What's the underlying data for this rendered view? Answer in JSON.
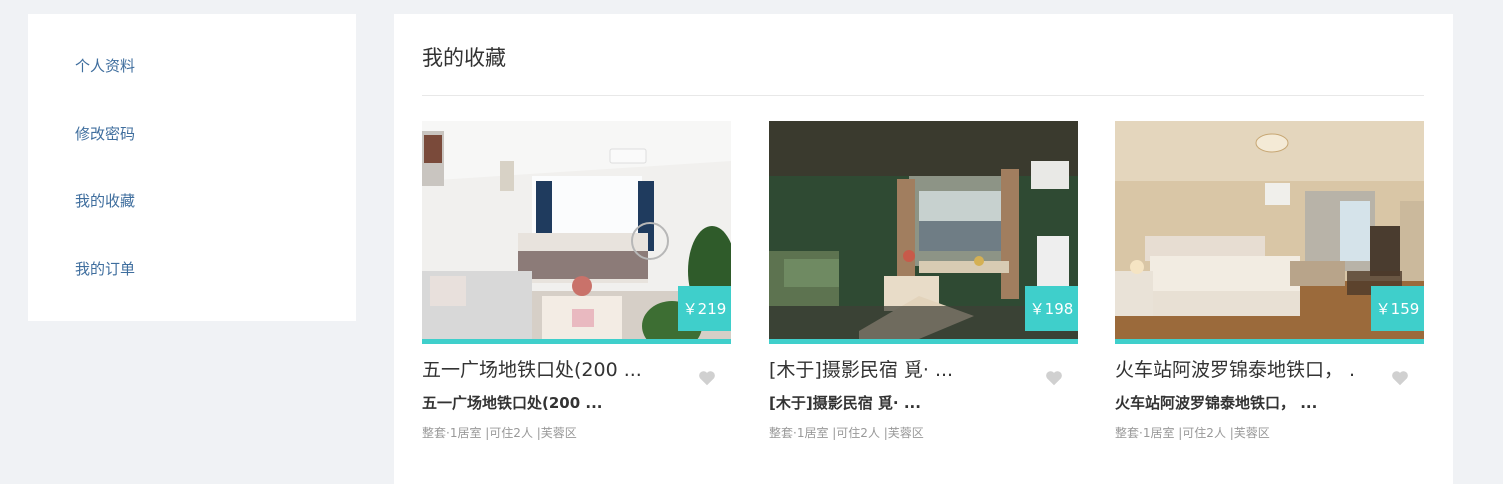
{
  "sidebar": {
    "items": [
      {
        "label": "个人资料"
      },
      {
        "label": "修改密码"
      },
      {
        "label": "我的收藏"
      },
      {
        "label": "我的订单"
      }
    ]
  },
  "main": {
    "title": "我的收藏",
    "cards": [
      {
        "price": "￥219",
        "title": "五一广场地铁口处(200 ...",
        "subtitle": "五一广场地铁口处(200 ...",
        "meta": "整套·1居室 |可住2人 |芙蓉区"
      },
      {
        "price": "￥198",
        "title": "[木于]摄影民宿 覓· ...",
        "subtitle": "[木于]摄影民宿 覓· ...",
        "meta": "整套·1居室 |可住2人 |芙蓉区"
      },
      {
        "price": "￥159",
        "title": "火车站阿波罗锦泰地铁口， ...",
        "subtitle": "火车站阿波罗锦泰地铁口， ...",
        "meta": "整套·1居室 |可住2人 |芙蓉区"
      }
    ]
  },
  "colors": {
    "accent": "#3fcfcb",
    "link": "#3f6e9e",
    "heart": "#d0d0d0"
  },
  "icons": {
    "favorite": "heart-icon"
  }
}
